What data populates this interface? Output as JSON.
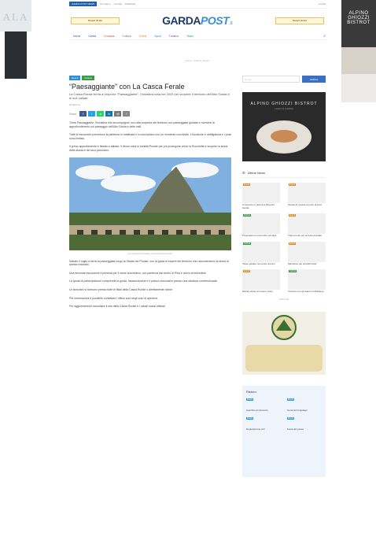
{
  "skin": {
    "left_logo": "ALA",
    "right_title": "ALPINO GHIOZZI BISTROT"
  },
  "topbar": {
    "pill": "GARDA POST NEWS",
    "links": [
      "Chi siamo",
      "Contatti",
      "Pubblicità"
    ],
    "right": "Accedi"
  },
  "header": {
    "ad_left": "Scopri di più",
    "ad_right": "Scopri di più",
    "brand_a": "GARDA",
    "brand_b": "POST",
    "brand_c": ".it"
  },
  "nav": {
    "items": [
      {
        "label": "Home",
        "color": "#1f5fa8"
      },
      {
        "label": "Garda",
        "color": "#1f5fa8"
      },
      {
        "label": "Cronaca",
        "color": "#d04a3a"
      },
      {
        "label": "Cultura",
        "color": "#3a9a4a"
      },
      {
        "label": "Eventi",
        "color": "#e08a1a"
      },
      {
        "label": "Sport",
        "color": "#2d8fd8"
      },
      {
        "label": "Turismo",
        "color": "#8a3ab9"
      },
      {
        "label": "Video",
        "color": "#1aa08a"
      }
    ],
    "search_icon": "search-icon"
  },
  "breadcrumb": "Home › Cultura › Eventi",
  "article": {
    "categories": [
      {
        "label": "Eventi",
        "color": "#2d8fd8"
      },
      {
        "label": "Cultura",
        "color": "#3a9a4a"
      }
    ],
    "title": "“Paesaggiante” con La Casca Ferale",
    "lede": "La Cassa Rurale torna a proporre “Paesaggiante”, l'iniziativa nata nel 2022 per scoprire il territorio dell'Alto Garda e le sue vallate.",
    "author": "Redazione",
    "date": "",
    "share_label": "Share",
    "share_buttons": [
      {
        "label": "f",
        "color": "#3b5998",
        "icon": "facebook-icon"
      },
      {
        "label": "t",
        "color": "#1da1f2",
        "icon": "twitter-icon"
      },
      {
        "label": "w",
        "color": "#25d366",
        "icon": "whatsapp-icon"
      },
      {
        "label": "in",
        "color": "#0e76a8",
        "icon": "linkedin-icon"
      },
      {
        "label": "@",
        "color": "#777777",
        "icon": "email-icon"
      },
      {
        "label": "+",
        "color": "#888888",
        "icon": "share-icon"
      }
    ],
    "paragraphs": [
      "Torna Paesaggiante, l'iniziativa che accompagna i soci alla scoperta del territorio con passeggiate guidate e momenti di approfondimento sul paesaggio dell'Alto Garda e delle valli.",
      "Tutte le escursioni prevedono la partenza in mattinata e si concludono con un momento conviviale. L'iscrizione è obbligatoria e i posti sono limitati.",
      "Il primo appuntamento è fissato a sabato: il ritrovo sarà in località Ponale per poi proseguire verso la Rocchetta e scoprire la storia della strada e dei suoi panorami."
    ],
    "caption": "La strada del Ponale vista dalla Rocchetta",
    "paragraphs_after": [
      "Sabato 9 luglio si terrà la passeggiata lungo la Strada del Ponale, con la guida di esperti del territorio che racconteranno la storia di questo tracciato.",
      "Una seconda escursione è prevista per il mese successivo, con partenza dal centro di Riva e arrivo al belvedere.",
      "La quota di partecipazione comprende la guida, l'assicurazione e il pranzo conclusivo presso una struttura convenzionata.",
      "Le iscrizioni si ricevono presso tutte le filiali della Cassa Rurale o direttamente online.",
      "Per informazioni è possibile contattare l'ufficio soci negli orari di apertura.",
      "Per aggiornamenti consultare il sito della Cassa Rurale e i canali social ufficiali."
    ]
  },
  "sidebar": {
    "search_placeholder": "Cerca...",
    "search_button": "CERCA",
    "ad_title": "ALPINO GHIOZZI BISTROT",
    "ad_sub": "LAGO DI GARDA",
    "latest_head": "Ultime News",
    "latest": [
      {
        "tag": "Eventi",
        "color": "#e08a1a",
        "title": "Il concerto in piazza a Riva del Garda"
      },
      {
        "tag": "Eventi",
        "color": "#e08a1a",
        "title": "Serata di musica al porto di Arco"
      },
      {
        "tag": "Cultura",
        "color": "#3a9a4a",
        "title": "Presentato il nuovo libro sul lago"
      },
      {
        "tag": "Eventi",
        "color": "#e08a1a",
        "title": "Tutto pronto per la festa d'estate"
      },
      {
        "tag": "Cultura",
        "color": "#3a9a4a",
        "title": "Visite guidate nel centro storico"
      },
      {
        "tag": "Eventi",
        "color": "#e08a1a",
        "title": "Mercatino dei prodotti locali"
      },
      {
        "tag": "Eventi",
        "color": "#e08a1a",
        "title": "Mostra d'arte al museo civico"
      },
      {
        "tag": "Cultura",
        "color": "#3a9a4a",
        "title": "Incontro con gli autori in biblioteca"
      }
    ],
    "more_label": "Vedi tutte",
    "box_head": "Ristoro",
    "box_items": [
      {
        "tag": "Eventi",
        "title": "Aperitivo al tramonto"
      },
      {
        "tag": "Eventi",
        "title": "Cena sul lungolago"
      },
      {
        "tag": "Eventi",
        "title": "Degustazione vini"
      },
      {
        "tag": "Eventi",
        "title": "Festa del pesce"
      }
    ]
  }
}
